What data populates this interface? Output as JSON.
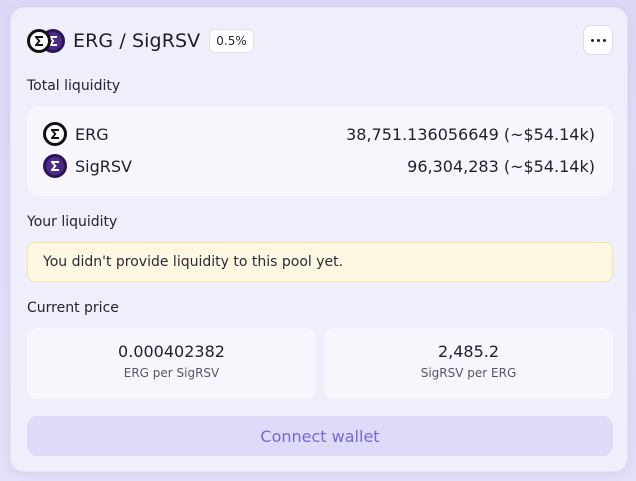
{
  "pool": {
    "title": "ERG / SigRSV",
    "fee": "0.5%",
    "token_a_icon": "erg-coin-icon",
    "token_b_icon": "sigrsv-coin-icon",
    "menu_icon": "more-dots-icon"
  },
  "total_liquidity": {
    "label": "Total liquidity",
    "rows": [
      {
        "token": "ERG",
        "amount": "38,751.136056649 (~$54.14k)",
        "icon": "erg-coin-icon"
      },
      {
        "token": "SigRSV",
        "amount": "96,304,283 (~$54.14k)",
        "icon": "sigrsv-coin-icon"
      }
    ]
  },
  "your_liquidity": {
    "label": "Your liquidity",
    "notice": "You didn't provide liquidity to this pool yet."
  },
  "current_price": {
    "label": "Current price",
    "prices": [
      {
        "value": "0.000402382",
        "unit": "ERG per SigRSV"
      },
      {
        "value": "2,485.2",
        "unit": "SigRSV per ERG"
      }
    ]
  },
  "actions": {
    "connect_label": "Connect wallet"
  },
  "colors": {
    "accent": "#7469d8",
    "button_bg": "#dedbf8",
    "notice_bg": "#fef8e3",
    "notice_border": "#f5e3a6",
    "sig_coin": "#4b2a8a",
    "erg_coin": "#111111"
  }
}
